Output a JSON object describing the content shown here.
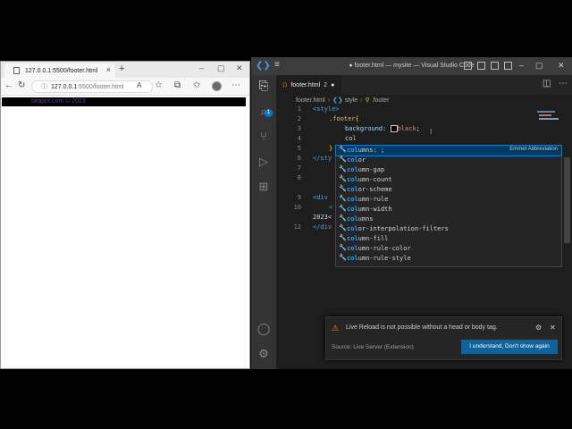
{
  "browser": {
    "tab_title": "127.0.0.1:5500/footer.html",
    "url_host": "127.0.0.1",
    "url_path": ":5500/footer.html",
    "footer_text": "seapot.com © 2023"
  },
  "vscode": {
    "window_title": "● footer.html — mysite — Visual Studio Code",
    "tab_label": "footer.html",
    "tab_problems": "2",
    "breadcrumb": [
      "footer.html",
      "style",
      ".footer"
    ],
    "line_numbers": [
      "1",
      "2",
      "3",
      "4",
      "5",
      "6",
      "7",
      "8",
      "9",
      "10",
      "11",
      "",
      "12"
    ],
    "code": {
      "l1": "<style>",
      "l2_sel": ".footer",
      "l2_brk": "{",
      "l3_prop": "background",
      "l3_val": "black",
      "l4": "col",
      "l5": "}",
      "l6": "</sty",
      "l9": "<div",
      "l10": "<",
      "l11": "2023<",
      "l12": "</div"
    },
    "suggestions": [
      {
        "match": "col",
        "rest": "umns: ;",
        "detail": "Emmet Abbreviation"
      },
      {
        "match": "col",
        "rest": "or",
        "detail": ""
      },
      {
        "match": "col",
        "rest": "umn-gap",
        "detail": ""
      },
      {
        "match": "col",
        "rest": "umn-count",
        "detail": ""
      },
      {
        "match": "col",
        "rest": "or-scheme",
        "detail": ""
      },
      {
        "match": "col",
        "rest": "umn-rule",
        "detail": ""
      },
      {
        "match": "col",
        "rest": "umn-width",
        "detail": ""
      },
      {
        "match": "col",
        "rest": "umns",
        "detail": ""
      },
      {
        "match": "col",
        "rest": "or-interpolation-filters",
        "detail": ""
      },
      {
        "match": "col",
        "rest": "umn-fill",
        "detail": ""
      },
      {
        "match": "col",
        "rest": "umn-rule-color",
        "detail": ""
      },
      {
        "match": "col",
        "rest": "umn-rule-style",
        "detail": ""
      }
    ],
    "notification": {
      "message": "Live Reload is not possible without a head or body tag.",
      "source": "Source: Live Server (Extension)",
      "button": "I understand, Don't show again"
    },
    "activity_badge": "1"
  },
  "colors": {
    "accent": "#007acc",
    "button": "#0e639c",
    "editor_bg": "#1e1e1e"
  }
}
